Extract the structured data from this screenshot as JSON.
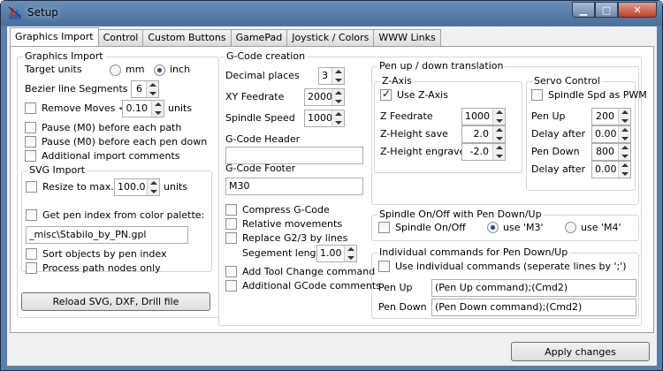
{
  "window": {
    "title": "Setup"
  },
  "tabs": [
    "Graphics Import",
    "Control",
    "Custom Buttons",
    "GamePad",
    "Joystick / Colors",
    "WWW Links"
  ],
  "gi": {
    "title": "Graphics Import",
    "target_units": "Target units",
    "mm": "mm",
    "inch": "inch",
    "bezier": "Bezier line Segments",
    "bezier_val": "6",
    "remove": "Remove Moves <",
    "remove_val": "0.10",
    "units": "units",
    "pause_path": "Pause (M0) before each path",
    "pause_pen": "Pause (M0) before each pen down",
    "addcomments": "Additional import comments"
  },
  "svg": {
    "title": "SVG Import",
    "resize": "Resize to max.",
    "resize_val": "100.0",
    "units": "units",
    "pen_index": "Get pen index from color palette:",
    "palette": "_misc\\Stabilo_by_PN.gpl",
    "sort": "Sort objects by pen index",
    "process": "Process path nodes only"
  },
  "reload": "Reload SVG, DXF, Drill file",
  "gcode": {
    "title": "G-Code creation",
    "decimal": "Decimal places",
    "decimal_val": "3",
    "xyfeed": "XY Feedrate",
    "xyfeed_val": "2000",
    "spindle": "Spindle Speed",
    "spindle_val": "1000",
    "header": "G-Code Header",
    "header_val": "",
    "footer": "G-Code Footer",
    "footer_val": "M30",
    "compress": "Compress G-Code",
    "relative": "Relative movements",
    "replace": "Replace G2/3 by lines",
    "seglen": "Segement length",
    "seglen_val": "1.00",
    "toolchange": "Add Tool Change command",
    "addgcode": "Additional GCode comments"
  },
  "pen": {
    "title": "Pen up / down translation",
    "zaxis": "Z-Axis",
    "usez": "Use Z-Axis",
    "zfeed": "Z Feedrate",
    "zfeed_val": "1000",
    "zsave": "Z-Height save",
    "zsave_val": "2.0",
    "zengrave": "Z-Height engrave",
    "zengrave_val": "-2.0"
  },
  "servo": {
    "title": "Servo Control",
    "spindle_pwm": "Spindle Spd as PWM",
    "penup": "Pen Up",
    "penup_val": "200",
    "delay1": "Delay after",
    "delay1_val": "0.00",
    "pendown": "Pen Down",
    "pendown_val": "800",
    "delay2": "Delay after",
    "delay2_val": "0.00"
  },
  "spindle": {
    "title": "Spindle On/Off with Pen Down/Up",
    "onoff": "Spindle On/Off",
    "m3": "use 'M3'",
    "m4": "use 'M4'"
  },
  "indiv": {
    "title": "Individual commands for Pen Down/Up",
    "use": "Use individual commands (seperate lines by ';')",
    "penup": "Pen Up",
    "penup_val": "(Pen Up command);(Cmd2)",
    "pendown": "Pen Down",
    "pendown_val": "(Pen Down command);(Cmd2)"
  },
  "apply": "Apply changes"
}
